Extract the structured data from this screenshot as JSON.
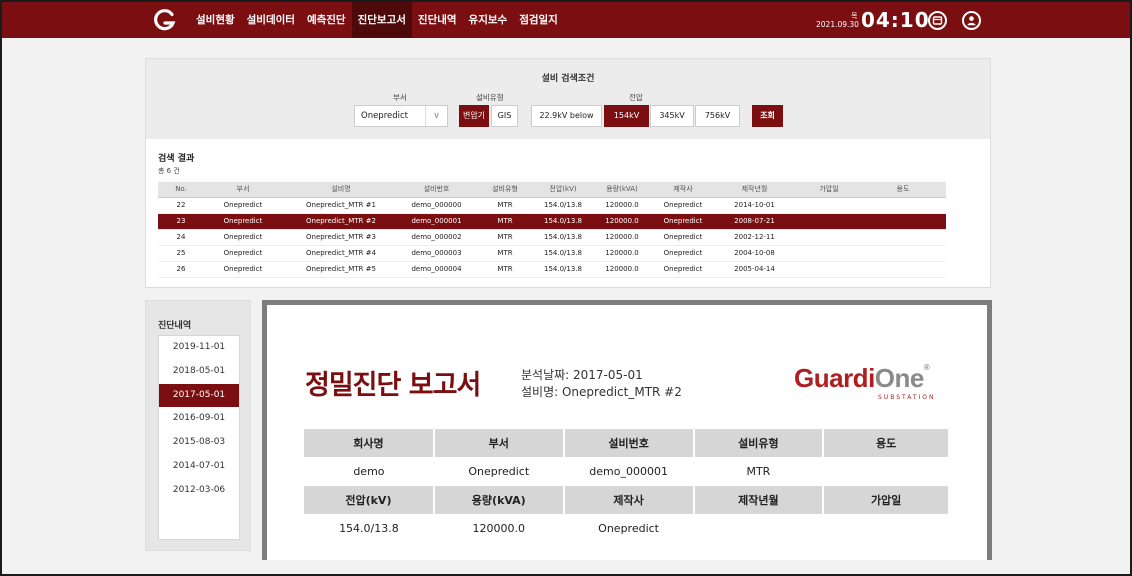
{
  "nav": {
    "items": [
      "설비현황",
      "설비데이터",
      "예측진단",
      "진단보고서",
      "진단내역",
      "유지보수",
      "점검일지"
    ],
    "active_index": 3
  },
  "clock": {
    "date": "2021.09.30",
    "weekday": "목",
    "time": "04:10"
  },
  "search": {
    "title": "설비 검색조건",
    "dept_label": "부서",
    "dept_value": "Onepredict",
    "type_label": "설비유형",
    "types": [
      "변압기",
      "GIS"
    ],
    "types_selected": "변압기",
    "voltage_label": "전압",
    "voltages": [
      "22.9kV below",
      "154kV",
      "345kV",
      "756kV"
    ],
    "voltages_selected": "154kV",
    "query_button": "조회"
  },
  "results": {
    "title": "검색 결과",
    "count": "총 6 건",
    "columns": [
      "No.",
      "부서",
      "설비명",
      "설비번호",
      "설비유형",
      "전압(kV)",
      "용량(kVA)",
      "제작사",
      "제작년월",
      "가압일",
      "용도"
    ],
    "rows": [
      [
        "22",
        "Onepredict",
        "Onepredict_MTR #1",
        "demo_000000",
        "MTR",
        "154.0/13.8",
        "120000.0",
        "Onepredict",
        "2014-10-01",
        "",
        ""
      ],
      [
        "23",
        "Onepredict",
        "Onepredict_MTR #2",
        "demo_000001",
        "MTR",
        "154.0/13.8",
        "120000.0",
        "Onepredict",
        "2008-07-21",
        "",
        ""
      ],
      [
        "24",
        "Onepredict",
        "Onepredict_MTR #3",
        "demo_000002",
        "MTR",
        "154.0/13.8",
        "120000.0",
        "Onepredict",
        "2002-12-11",
        "",
        ""
      ],
      [
        "25",
        "Onepredict",
        "Onepredict_MTR #4",
        "demo_000003",
        "MTR",
        "154.0/13.8",
        "120000.0",
        "Onepredict",
        "2004-10-08",
        "",
        ""
      ],
      [
        "26",
        "Onepredict",
        "Onepredict_MTR #5",
        "demo_000004",
        "MTR",
        "154.0/13.8",
        "120000.0",
        "Onepredict",
        "2005-04-14",
        "",
        ""
      ]
    ],
    "selected_index": 1
  },
  "history": {
    "title": "진단내역",
    "items": [
      "2019-11-01",
      "2018-05-01",
      "2017-05-01",
      "2016-09-01",
      "2015-08-03",
      "2014-07-01",
      "2012-03-06"
    ],
    "selected_index": 2
  },
  "report": {
    "title": "정밀진단 보고서",
    "analysis_date": "분석날짜: 2017-05-01",
    "equipment_name": "설비명: Onepredict_MTR #2",
    "brand_a": "Guardi",
    "brand_b": "One",
    "brand_sub": "SUBSTATION",
    "header1": [
      "회사명",
      "부서",
      "설비번호",
      "설비유형",
      "용도"
    ],
    "row1": [
      "demo",
      "Onepredict",
      "demo_000001",
      "MTR",
      ""
    ],
    "header2": [
      "전압(kV)",
      "용량(kVA)",
      "제작사",
      "제작년월",
      "가압일"
    ],
    "row2": [
      "154.0/13.8",
      "120000.0",
      "Onepredict",
      "",
      ""
    ]
  },
  "colors": {
    "brand": "#7a0e10",
    "brand_dark": "#4e0a0b"
  }
}
